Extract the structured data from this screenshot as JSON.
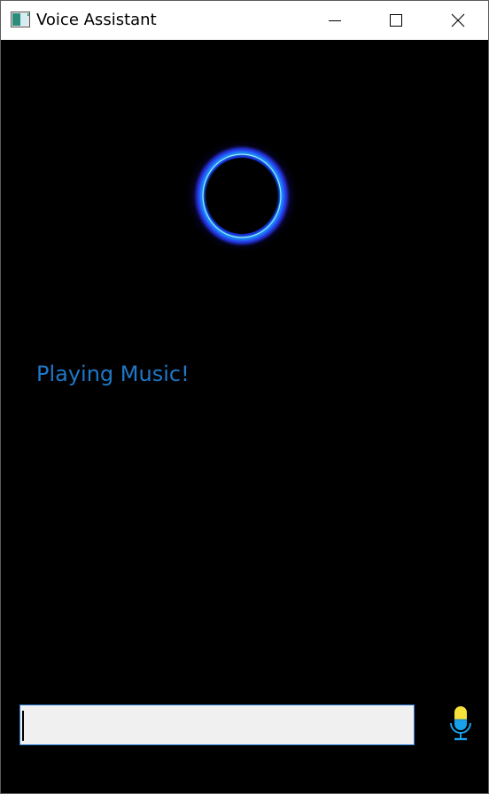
{
  "window": {
    "title": "Voice Assistant",
    "icon": "app-window-icon",
    "controls": {
      "minimize_icon": "minimize-icon",
      "maximize_icon": "maximize-icon",
      "close_icon": "close-icon"
    }
  },
  "assistant": {
    "status": "Playing Music!",
    "status_color": "#1e78c8",
    "orb_icon": "listening-orb-icon",
    "orb_color": "#18b4ff"
  },
  "input": {
    "value": "",
    "placeholder": ""
  },
  "mic": {
    "icon": "microphone-icon",
    "color_top": "#f6e03a",
    "color_bottom": "#1aa0e8"
  }
}
